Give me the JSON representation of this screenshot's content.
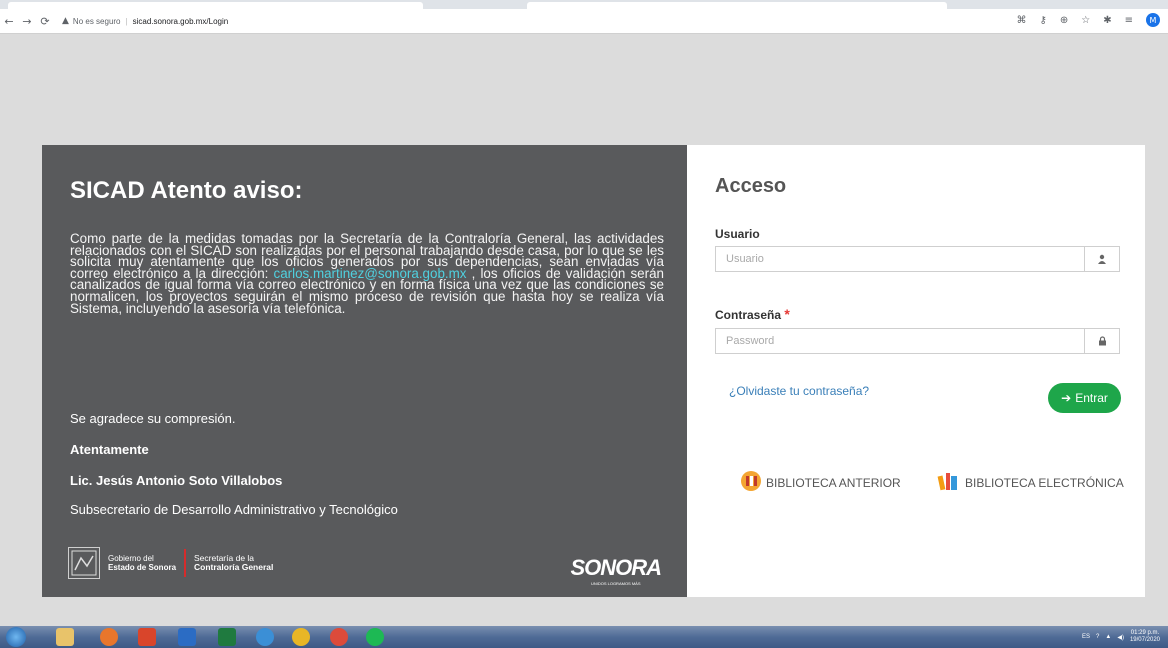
{
  "browser": {
    "security_label": "No es seguro",
    "url": "sicad.sonora.gob.mx/Login",
    "profile_initial": "M"
  },
  "notice": {
    "title": "SICAD Atento aviso:",
    "body_before_email": "Como parte de la medidas tomadas por la Secretaría de la Contraloría General, las actividades relacionados con el SICAD son realizadas por el personal trabajando desde casa, por lo que se les solicita muy atentamente que los oficios generados por sus dependencias, sean enviadas vía correo electrónico a la dirección:",
    "email": "carlos.martinez@sonora.gob.mx",
    "body_after_email": ", los oficios de validación serán canalizados de igual forma vía correo electrónico y en forma física una vez que las condiciones se normalicen, los proyectos seguirán el mismo proceso de revisión que hasta hoy se realiza vía Sistema, incluyendo la asesoría vía telefónica.",
    "thanks": "Se agradece su compresión.",
    "regards": "Atentamente",
    "signer": "Lic. Jesús Antonio Soto Villalobos",
    "role": "Subsecretario de Desarrollo Administrativo y Tecnológico",
    "gob_line1": "Gobierno del",
    "gob_line2": "Estado de Sonora",
    "sec_line1": "Secretaría de la",
    "sec_line2": "Contraloría General",
    "sonora_logo": "SONORA",
    "sonora_tagline": "UNIDOS LOGRAMOS MÁS"
  },
  "login": {
    "title": "Acceso",
    "user_label": "Usuario",
    "user_placeholder": "Usuario",
    "password_label": "Contraseña",
    "password_required": "*",
    "password_placeholder": "Password",
    "forgot": "¿Olvidaste tu contraseña?",
    "submit": "Entrar",
    "lib_prev": "BIBLIOTECA ANTERIOR",
    "lib_elec": "BIBLIOTECA ELECTRÓNICA"
  },
  "taskbar": {
    "lang": "ES",
    "time": "01:29 p.m.",
    "date": "19/07/2020"
  },
  "colors": {
    "notice_bg": "#595a5c",
    "email": "#4fd1e0",
    "entrar": "#1ea64a",
    "link": "#3a7fb8"
  }
}
